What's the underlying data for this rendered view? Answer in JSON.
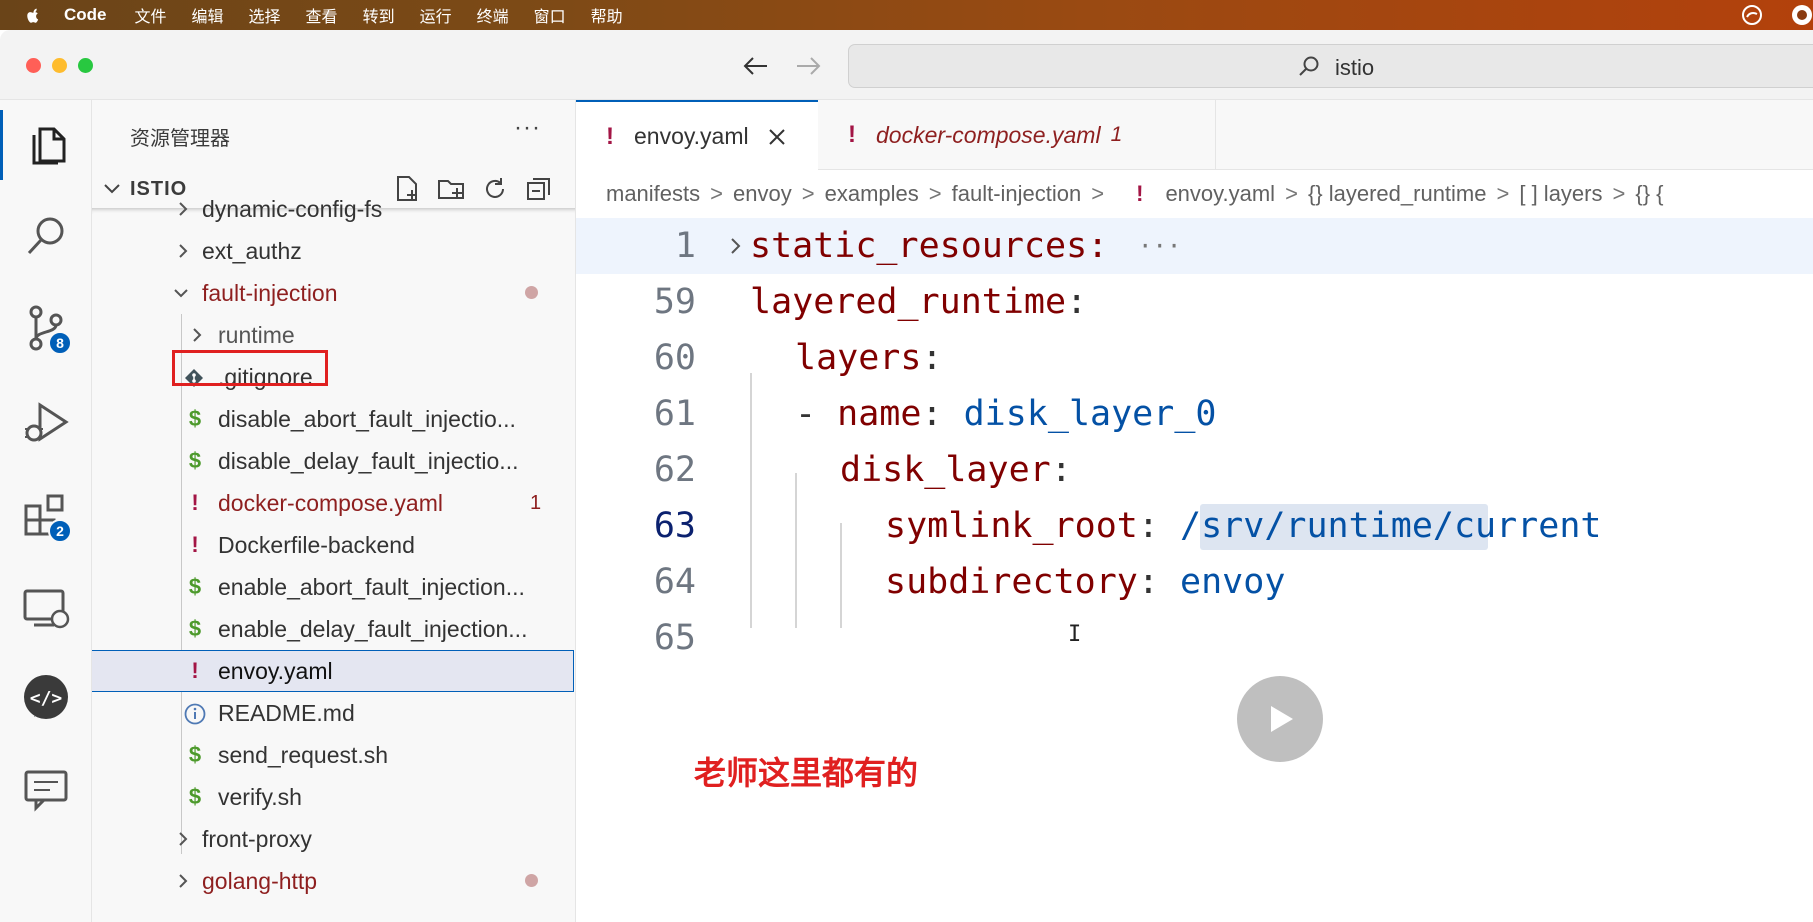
{
  "menubar": {
    "app_name": "Code",
    "items": [
      "文件",
      "编辑",
      "选择",
      "查看",
      "转到",
      "运行",
      "终端",
      "窗口",
      "帮助"
    ]
  },
  "titlebar": {
    "search_text": "istio"
  },
  "activity": {
    "scm_badge": "8",
    "extensions_badge": "2"
  },
  "sidebar": {
    "title": "资源管理器",
    "more": "···",
    "section": "ISTIO",
    "tree": [
      {
        "label": "dynamic-config-fs",
        "kind": "folder"
      },
      {
        "label": "ext_authz",
        "kind": "folder"
      },
      {
        "label": "fault-injection",
        "kind": "folder-open"
      },
      {
        "label": "runtime",
        "kind": "folder"
      },
      {
        "label": ".gitignore",
        "kind": "git"
      },
      {
        "label": "disable_abort_fault_injectio...",
        "kind": "shell"
      },
      {
        "label": "disable_delay_fault_injectio...",
        "kind": "shell"
      },
      {
        "label": "docker-compose.yaml",
        "kind": "yaml-error",
        "count": "1"
      },
      {
        "label": "Dockerfile-backend",
        "kind": "yaml"
      },
      {
        "label": "enable_abort_fault_injection...",
        "kind": "shell"
      },
      {
        "label": "enable_delay_fault_injection...",
        "kind": "shell"
      },
      {
        "label": "envoy.yaml",
        "kind": "yaml"
      },
      {
        "label": "README.md",
        "kind": "info"
      },
      {
        "label": "send_request.sh",
        "kind": "shell"
      },
      {
        "label": "verify.sh",
        "kind": "shell"
      },
      {
        "label": "front-proxy",
        "kind": "folder"
      },
      {
        "label": "golang-http",
        "kind": "folder"
      }
    ]
  },
  "tabs": [
    {
      "label": "envoy.yaml",
      "active": true
    },
    {
      "label": "docker-compose.yaml",
      "count": "1",
      "active": false
    }
  ],
  "breadcrumbs": [
    "manifests",
    "envoy",
    "examples",
    "fault-injection",
    "envoy.yaml",
    "{} layered_runtime",
    "[ ] layers",
    "{} {"
  ],
  "code": [
    {
      "num": "1",
      "text": "static_resources:",
      "ellipsis": "···"
    },
    {
      "num": "59",
      "key": "layered_runtime",
      "sep": ":"
    },
    {
      "num": "60",
      "key": "layers",
      "sep": ":"
    },
    {
      "num": "61",
      "dash": "- ",
      "key": "name",
      "sep": ": ",
      "value": "disk_layer_0"
    },
    {
      "num": "62",
      "key": "disk_layer",
      "sep": ":"
    },
    {
      "num": "63",
      "key": "symlink_root",
      "sep": ": ",
      "value": "/srv/runtime/current"
    },
    {
      "num": "64",
      "key": "subdirectory",
      "sep": ": ",
      "value": "envoy"
    },
    {
      "num": "65"
    }
  ],
  "caption": "老师这里都有的",
  "colors": {
    "accent": "#005fb8",
    "yaml_key": "#800000",
    "yaml_value": "#0451a5",
    "caption": "#e02020"
  }
}
